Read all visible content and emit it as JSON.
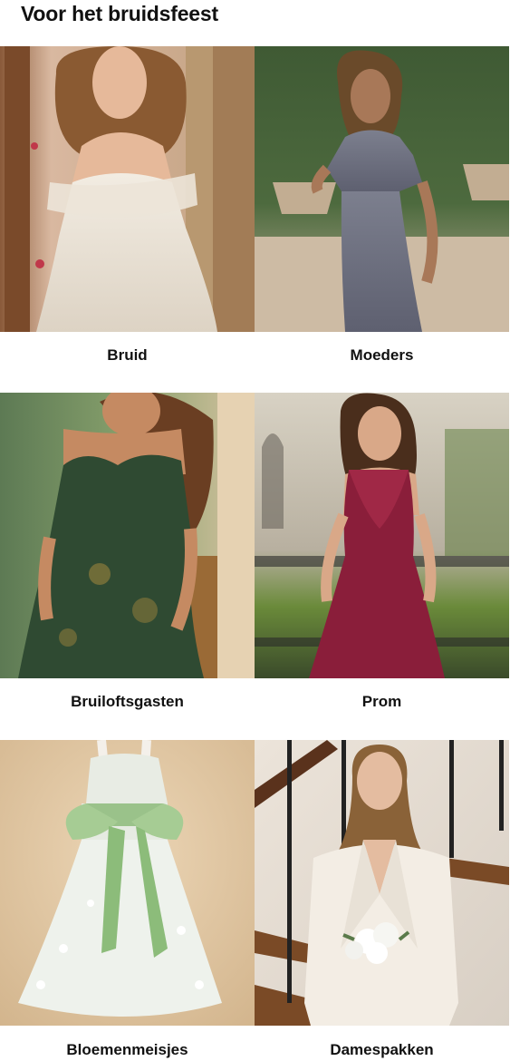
{
  "section": {
    "title": "Voor het bruidsfeest"
  },
  "categories": [
    {
      "label": "Bruid",
      "image": "bride-lace-dress-photo"
    },
    {
      "label": "Moeders",
      "image": "grey-sequin-dress-photo"
    },
    {
      "label": "Bruiloftsgasten",
      "image": "green-floral-dress-photo"
    },
    {
      "label": "Prom",
      "image": "burgundy-lace-dress-photo"
    },
    {
      "label": "Bloemenmeisjes",
      "image": "flower-girl-dress-photo"
    },
    {
      "label": "Damespakken",
      "image": "white-bridal-suit-photo"
    }
  ],
  "colors": {
    "background": "#ffffff",
    "text": "#111111"
  }
}
